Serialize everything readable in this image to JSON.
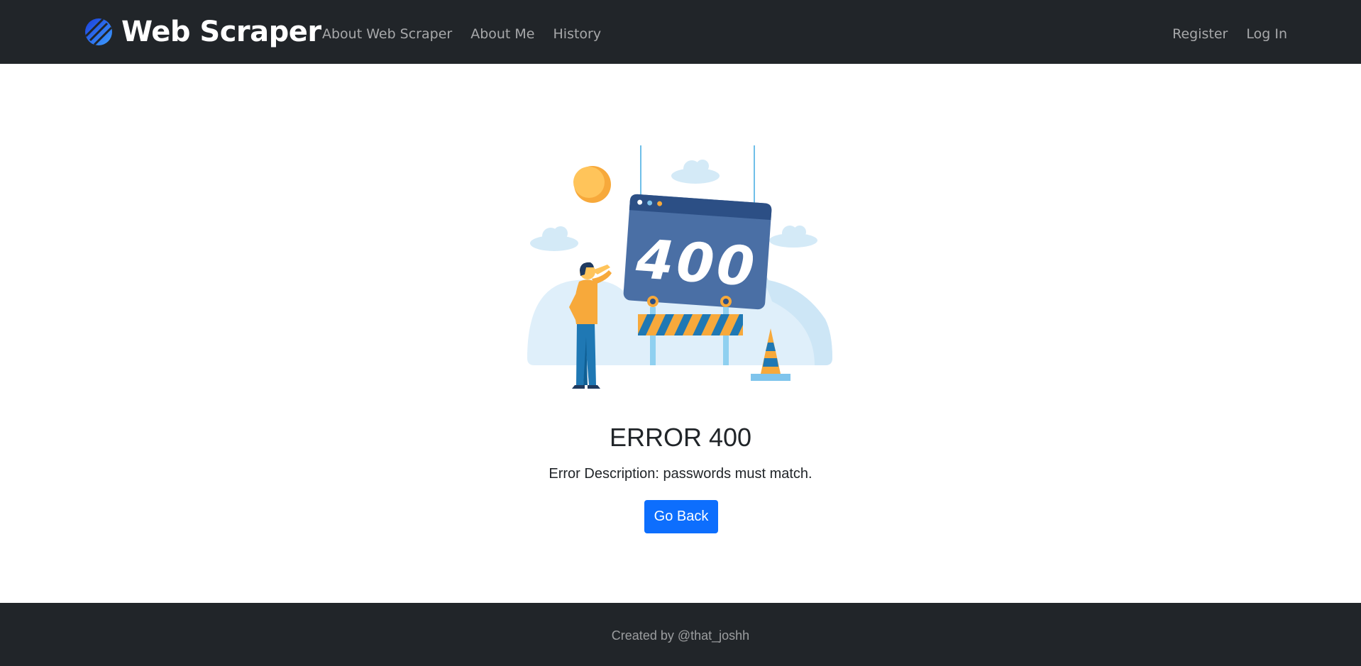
{
  "header": {
    "brand_name": "Web Scraper",
    "brand_icon": "diagonal-stripes-logo-icon",
    "nav_left": [
      {
        "label": "About Web Scraper"
      },
      {
        "label": "About Me"
      },
      {
        "label": "History"
      }
    ],
    "nav_right": [
      {
        "label": "Register"
      },
      {
        "label": "Log In"
      }
    ]
  },
  "main": {
    "illustration": {
      "sign_text": "400",
      "icon": "under-construction-illustration"
    },
    "title": "ERROR 400",
    "description": "Error Description: passwords must match.",
    "button_label": "Go Back"
  },
  "footer": {
    "text": "Created by @that_joshh"
  },
  "colors": {
    "navbar_bg": "#212529",
    "primary_button": "#0d6efd",
    "sign_blue": "#4a6fa5",
    "accent_orange": "#f7a93b",
    "stripe_blue": "#1f78b4"
  }
}
